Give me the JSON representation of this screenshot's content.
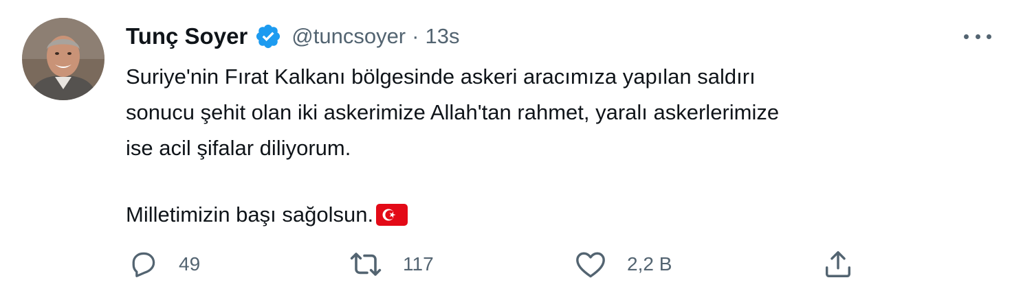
{
  "tweet": {
    "author": {
      "name": "Tunç Soyer",
      "handle": "@tuncsoyer",
      "verified_icon": "verified-badge-icon",
      "avatar_icon": "profile-photo"
    },
    "separator": "·",
    "time": "13s",
    "more_icon": "more-horizontal-icon",
    "text_lines": [
      "Suriye'nin Fırat Kalkanı bölgesinde askeri aracımıza yapılan saldırı",
      "sonucu şehit olan iki askerimize Allah'tan rahmet, yaralı askerlerimize",
      "ise acil şifalar diliyorum.",
      "Milletimizin başı sağolsun."
    ],
    "emoji": "turkey-flag-emoji"
  },
  "actions": {
    "reply": {
      "icon": "reply-icon",
      "count": "49"
    },
    "retweet": {
      "icon": "retweet-icon",
      "count": "117"
    },
    "like": {
      "icon": "heart-icon",
      "count": "2,2 B"
    },
    "share": {
      "icon": "share-icon"
    }
  },
  "colors": {
    "text_primary": "#0f1419",
    "text_secondary": "#536471",
    "verified_blue": "#1d9bf0",
    "flag_red": "#e30a17"
  }
}
